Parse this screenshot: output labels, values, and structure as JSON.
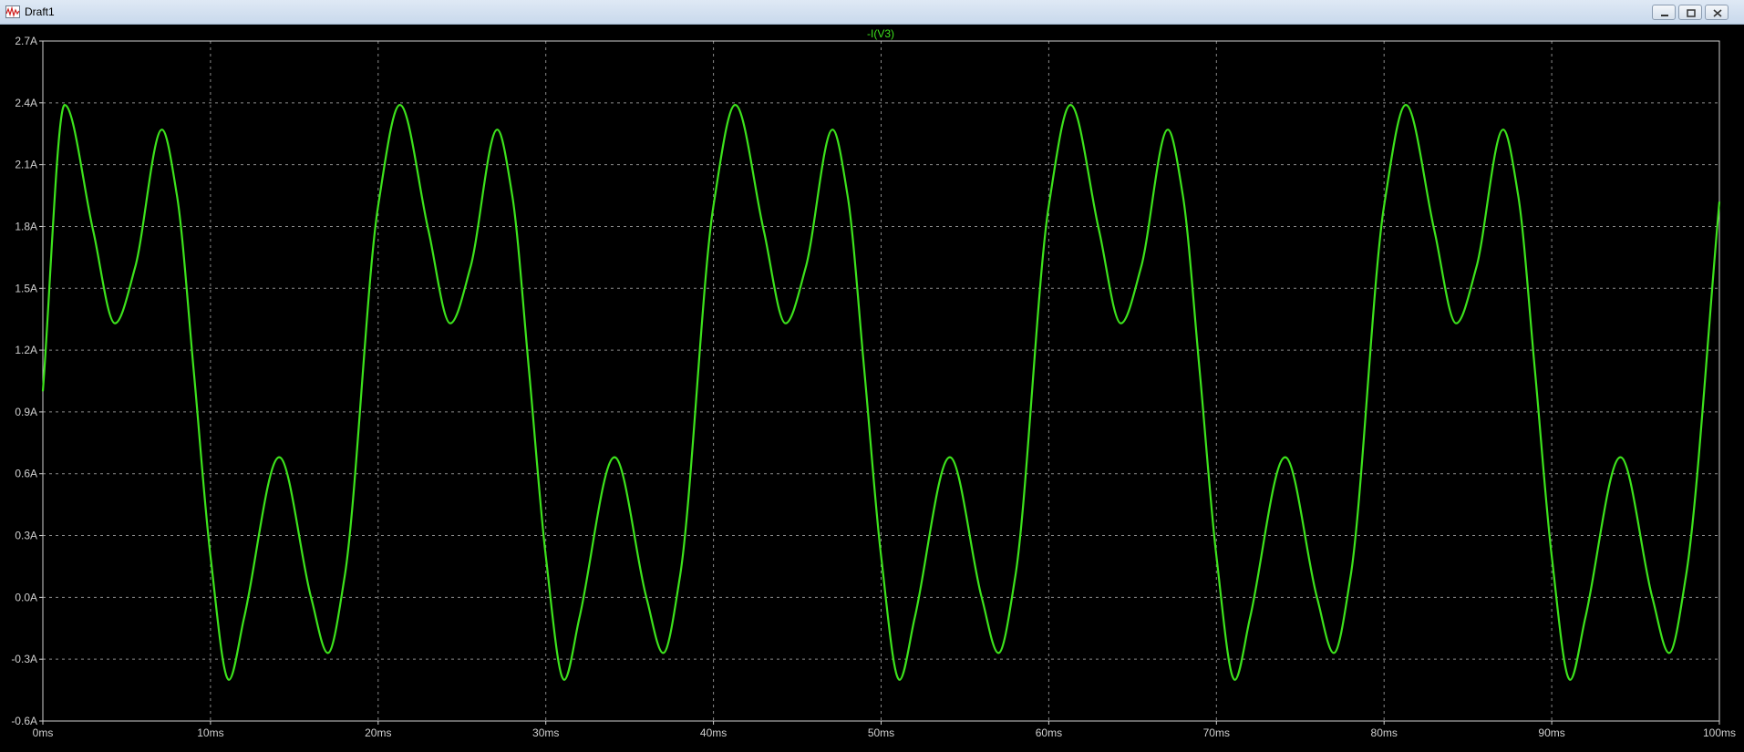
{
  "window": {
    "title": "Draft1",
    "controls": [
      "minimize-icon",
      "restore-icon",
      "close-icon"
    ]
  },
  "colors": {
    "background": "#000000",
    "trace": "#3de21c",
    "grid": "#8a8a8a",
    "axis_text": "#d0d0d0"
  },
  "chart_data": {
    "type": "line",
    "title": "-I(V3)",
    "xlabel": "",
    "ylabel": "",
    "grid": true,
    "x_unit": "ms",
    "y_unit": "A",
    "xlim": [
      0,
      100
    ],
    "ylim": [
      -0.6,
      2.7
    ],
    "x_ticks": [
      "0ms",
      "10ms",
      "20ms",
      "30ms",
      "40ms",
      "50ms",
      "60ms",
      "70ms",
      "80ms",
      "90ms",
      "100ms"
    ],
    "y_ticks": [
      "2.7A",
      "2.4A",
      "2.1A",
      "1.8A",
      "1.5A",
      "1.2A",
      "0.9A",
      "0.6A",
      "0.3A",
      "0.0A",
      "-0.3A",
      "-0.6A"
    ],
    "series": [
      {
        "name": "-I(V3)",
        "color": "#3de21c",
        "x": [
          0,
          1.3,
          3,
          4.3,
          5.5,
          7.1,
          8,
          9,
          10,
          11.1,
          12,
          14.1,
          16,
          17,
          18,
          20,
          21.3,
          23,
          24.3,
          25.5,
          27.1,
          28,
          29,
          30,
          31.1,
          32,
          34.1,
          36,
          37,
          38,
          40,
          41.3,
          43,
          44.3,
          45.5,
          47.1,
          48,
          49,
          50,
          51.1,
          52,
          54.1,
          56,
          57,
          58,
          60,
          61.3,
          63,
          64.3,
          65.5,
          67.1,
          68,
          69,
          70,
          71.1,
          72,
          74.1,
          76,
          77,
          78,
          80,
          81.3,
          83,
          84.3,
          85.5,
          87.1,
          88,
          89,
          90,
          91.1,
          92,
          94.1,
          96,
          97,
          98,
          100
        ],
        "y": [
          1.0,
          2.39,
          1.78,
          1.33,
          1.6,
          2.27,
          1.95,
          1.1,
          0.2,
          -0.4,
          -0.1,
          0.68,
          0.0,
          -0.27,
          0.1,
          1.9,
          2.39,
          1.78,
          1.33,
          1.6,
          2.27,
          1.95,
          1.1,
          0.2,
          -0.4,
          -0.1,
          0.68,
          0.0,
          -0.27,
          0.1,
          1.9,
          2.39,
          1.78,
          1.33,
          1.6,
          2.27,
          1.95,
          1.1,
          0.2,
          -0.4,
          -0.1,
          0.68,
          0.0,
          -0.27,
          0.1,
          1.9,
          2.39,
          1.78,
          1.33,
          1.6,
          2.27,
          1.95,
          1.1,
          0.2,
          -0.4,
          -0.1,
          0.68,
          0.0,
          -0.27,
          0.1,
          1.9,
          2.39,
          1.78,
          1.33,
          1.6,
          2.27,
          1.95,
          1.1,
          0.2,
          -0.4,
          -0.1,
          0.68,
          0.0,
          -0.27,
          0.1,
          1.92
        ]
      }
    ]
  }
}
